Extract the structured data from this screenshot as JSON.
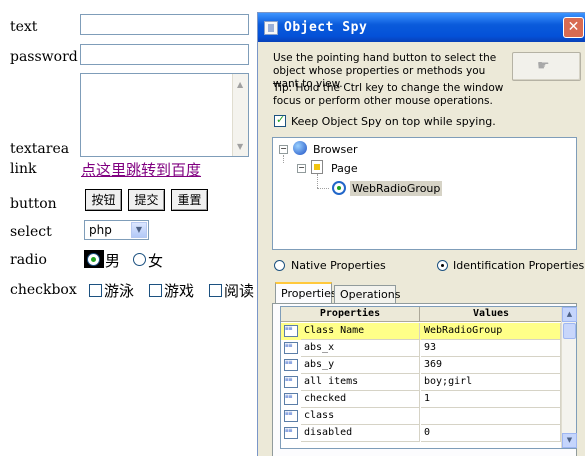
{
  "form": {
    "text_label": "text",
    "password_label": "password",
    "textarea_label": "textarea",
    "link_label": "link",
    "link_text": "点这里跳转到百度",
    "button_label": "button",
    "buttons": [
      "按钮",
      "提交",
      "重置"
    ],
    "select_label": "select",
    "select_value": "php",
    "radio_label": "radio",
    "radio_options": [
      "男",
      "女"
    ],
    "radio_selected": "男",
    "checkbox_label": "checkbox",
    "checkbox_options": [
      "游泳",
      "游戏",
      "阅读"
    ]
  },
  "spy": {
    "title": "Object Spy",
    "instructions": "Use the pointing hand button to select the object whose properties or methods you want to view.",
    "tip": "Tip: Hold the Ctrl key to change the window focus or perform other mouse operations.",
    "keep_on_top_label": "Keep Object Spy on top while spying.",
    "keep_on_top_checked": true,
    "tree": [
      "Browser",
      "Page",
      "WebRadioGroup"
    ],
    "native_properties_label": "Native Properties",
    "identification_properties_label": "Identification Properties",
    "selected_mode": "Identification Properties",
    "tabs": [
      "Properties",
      "Operations"
    ],
    "active_tab": "Properties",
    "grid_headers": [
      "Properties",
      "Values"
    ],
    "grid_rows": [
      {
        "property": "Class Name",
        "value": "WebRadioGroup"
      },
      {
        "property": "abs_x",
        "value": "93"
      },
      {
        "property": "abs_y",
        "value": "369"
      },
      {
        "property": "all items",
        "value": "boy;girl"
      },
      {
        "property": "checked",
        "value": "1"
      },
      {
        "property": "class",
        "value": ""
      },
      {
        "property": "disabled",
        "value": "0"
      }
    ],
    "selected_row": "Class Name",
    "colors": {
      "selected_row": "#ffff88",
      "title_bar": "#0a5bdb",
      "link": "#800080"
    }
  }
}
